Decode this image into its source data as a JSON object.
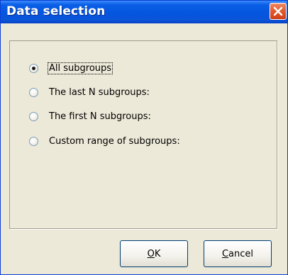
{
  "window": {
    "title": "Data selection"
  },
  "options": [
    {
      "label": "All subgroups",
      "selected": true
    },
    {
      "label": "The last N subgroups:",
      "selected": false
    },
    {
      "label": "The first N subgroups:",
      "selected": false
    },
    {
      "label": "Custom range of subgroups:",
      "selected": false
    }
  ],
  "buttons": {
    "ok": {
      "mnemonic": "O",
      "rest": "K"
    },
    "cancel": {
      "mnemonic": "C",
      "rest": "ancel"
    }
  }
}
